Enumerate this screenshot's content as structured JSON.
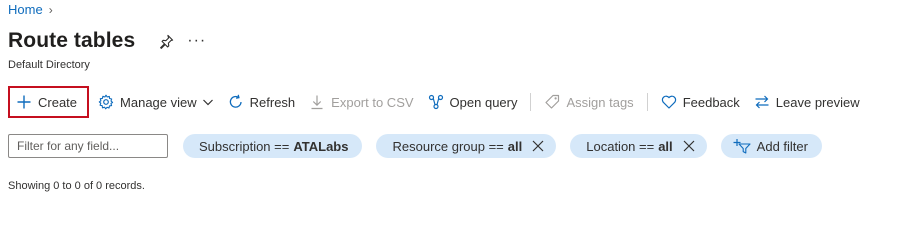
{
  "breadcrumb": {
    "home": "Home",
    "separator": "›"
  },
  "header": {
    "title": "Route tables",
    "subtitle": "Default Directory",
    "more": "···"
  },
  "toolbar": {
    "create": "Create",
    "manage_view": "Manage view",
    "refresh": "Refresh",
    "export_csv": "Export to CSV",
    "open_query": "Open query",
    "assign_tags": "Assign tags",
    "feedback": "Feedback",
    "leave_preview": "Leave preview"
  },
  "filters": {
    "search_placeholder": "Filter for any field...",
    "subscription": {
      "label": "Subscription ==",
      "value": "ATALabs"
    },
    "resource_group": {
      "label": "Resource group ==",
      "value": "all"
    },
    "location": {
      "label": "Location ==",
      "value": "all"
    },
    "add_filter": "Add filter"
  },
  "status": {
    "records": "Showing 0 to 0 of 0 records."
  },
  "colors": {
    "accent": "#0f6cbd",
    "pill_bg": "#d6e8f9",
    "highlight_border": "#c50f1f"
  }
}
